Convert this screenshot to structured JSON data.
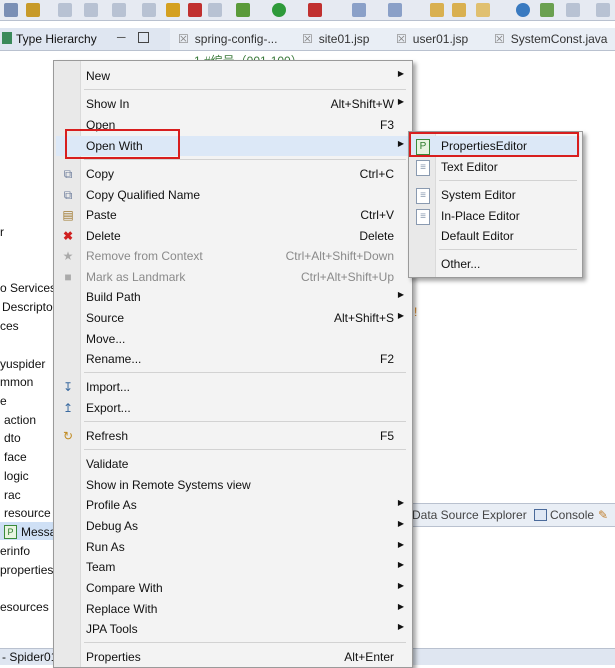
{
  "left_view": {
    "tab_title": "Type Hierarchy",
    "tree_items": [
      "r",
      "o Services",
      "Descripto",
      "ces",
      "yuspider",
      "mmon",
      "e",
      "action",
      "dto",
      "face",
      "logic",
      "rac",
      "resource",
      "Messa",
      "erinfo",
      "properties",
      "esources"
    ]
  },
  "editor": {
    "tabs": [
      "spring-config-...",
      "site01.jsp",
      "user01.jsp",
      "SystemConst.java"
    ],
    "line_text": "1 #编号（001-100）"
  },
  "bottom": {
    "tabs": [
      "Data Source Explorer",
      "Console"
    ]
  },
  "status": {
    "text": "- Spider01"
  },
  "context_menu": {
    "items": [
      {
        "label": "New",
        "shortcut": "",
        "submenu": true,
        "icon": ""
      },
      {
        "label": "Show In",
        "shortcut": "Alt+Shift+W",
        "submenu": true,
        "icon": ""
      },
      {
        "label": "Open",
        "shortcut": "F3",
        "submenu": false,
        "icon": ""
      },
      {
        "label": "Open With",
        "shortcut": "",
        "submenu": true,
        "icon": ""
      },
      {
        "label": "Copy",
        "shortcut": "Ctrl+C",
        "submenu": false,
        "icon": "copy-icon"
      },
      {
        "label": "Copy Qualified Name",
        "shortcut": "",
        "submenu": false,
        "icon": "copy-qualified-icon"
      },
      {
        "label": "Paste",
        "shortcut": "Ctrl+V",
        "submenu": false,
        "icon": "paste-icon"
      },
      {
        "label": "Delete",
        "shortcut": "Delete",
        "submenu": false,
        "icon": "delete-icon"
      },
      {
        "label": "Remove from Context",
        "shortcut": "Ctrl+Alt+Shift+Down",
        "submenu": false,
        "disabled": true,
        "icon": "remove-context-icon"
      },
      {
        "label": "Mark as Landmark",
        "shortcut": "Ctrl+Alt+Shift+Up",
        "submenu": false,
        "disabled": true,
        "icon": "landmark-icon"
      },
      {
        "label": "Build Path",
        "shortcut": "",
        "submenu": true,
        "icon": ""
      },
      {
        "label": "Source",
        "shortcut": "Alt+Shift+S",
        "submenu": true,
        "icon": ""
      },
      {
        "label": "Move...",
        "shortcut": "",
        "submenu": false,
        "icon": ""
      },
      {
        "label": "Rename...",
        "shortcut": "F2",
        "submenu": false,
        "icon": ""
      },
      {
        "label": "Import...",
        "shortcut": "",
        "submenu": false,
        "icon": "import-icon"
      },
      {
        "label": "Export...",
        "shortcut": "",
        "submenu": false,
        "icon": "export-icon"
      },
      {
        "label": "Refresh",
        "shortcut": "F5",
        "submenu": false,
        "icon": "refresh-icon"
      },
      {
        "label": "Validate",
        "shortcut": "",
        "submenu": false,
        "icon": ""
      },
      {
        "label": "Show in Remote Systems view",
        "shortcut": "",
        "submenu": false,
        "icon": ""
      },
      {
        "label": "Profile As",
        "shortcut": "",
        "submenu": true,
        "icon": ""
      },
      {
        "label": "Debug As",
        "shortcut": "",
        "submenu": true,
        "icon": ""
      },
      {
        "label": "Run As",
        "shortcut": "",
        "submenu": true,
        "icon": ""
      },
      {
        "label": "Team",
        "shortcut": "",
        "submenu": true,
        "icon": ""
      },
      {
        "label": "Compare With",
        "shortcut": "",
        "submenu": true,
        "icon": ""
      },
      {
        "label": "Replace With",
        "shortcut": "",
        "submenu": true,
        "icon": ""
      },
      {
        "label": "JPA Tools",
        "shortcut": "",
        "submenu": true,
        "icon": ""
      },
      {
        "label": "Properties",
        "shortcut": "Alt+Enter",
        "submenu": false,
        "icon": ""
      }
    ]
  },
  "open_with_submenu": {
    "items": [
      {
        "label": "PropertiesEditor",
        "icon": "properties-editor-icon"
      },
      {
        "label": "Text Editor",
        "icon": "text-editor-icon"
      },
      {
        "label": "System Editor",
        "icon": "system-editor-icon"
      },
      {
        "label": "In-Place Editor",
        "icon": "inplace-editor-icon"
      },
      {
        "label": "Default Editor",
        "icon": ""
      },
      {
        "label": "Other...",
        "icon": ""
      }
    ]
  },
  "colors": {
    "highlight_border": "#d81e1e",
    "menu_bg": "#f3f3f3"
  }
}
